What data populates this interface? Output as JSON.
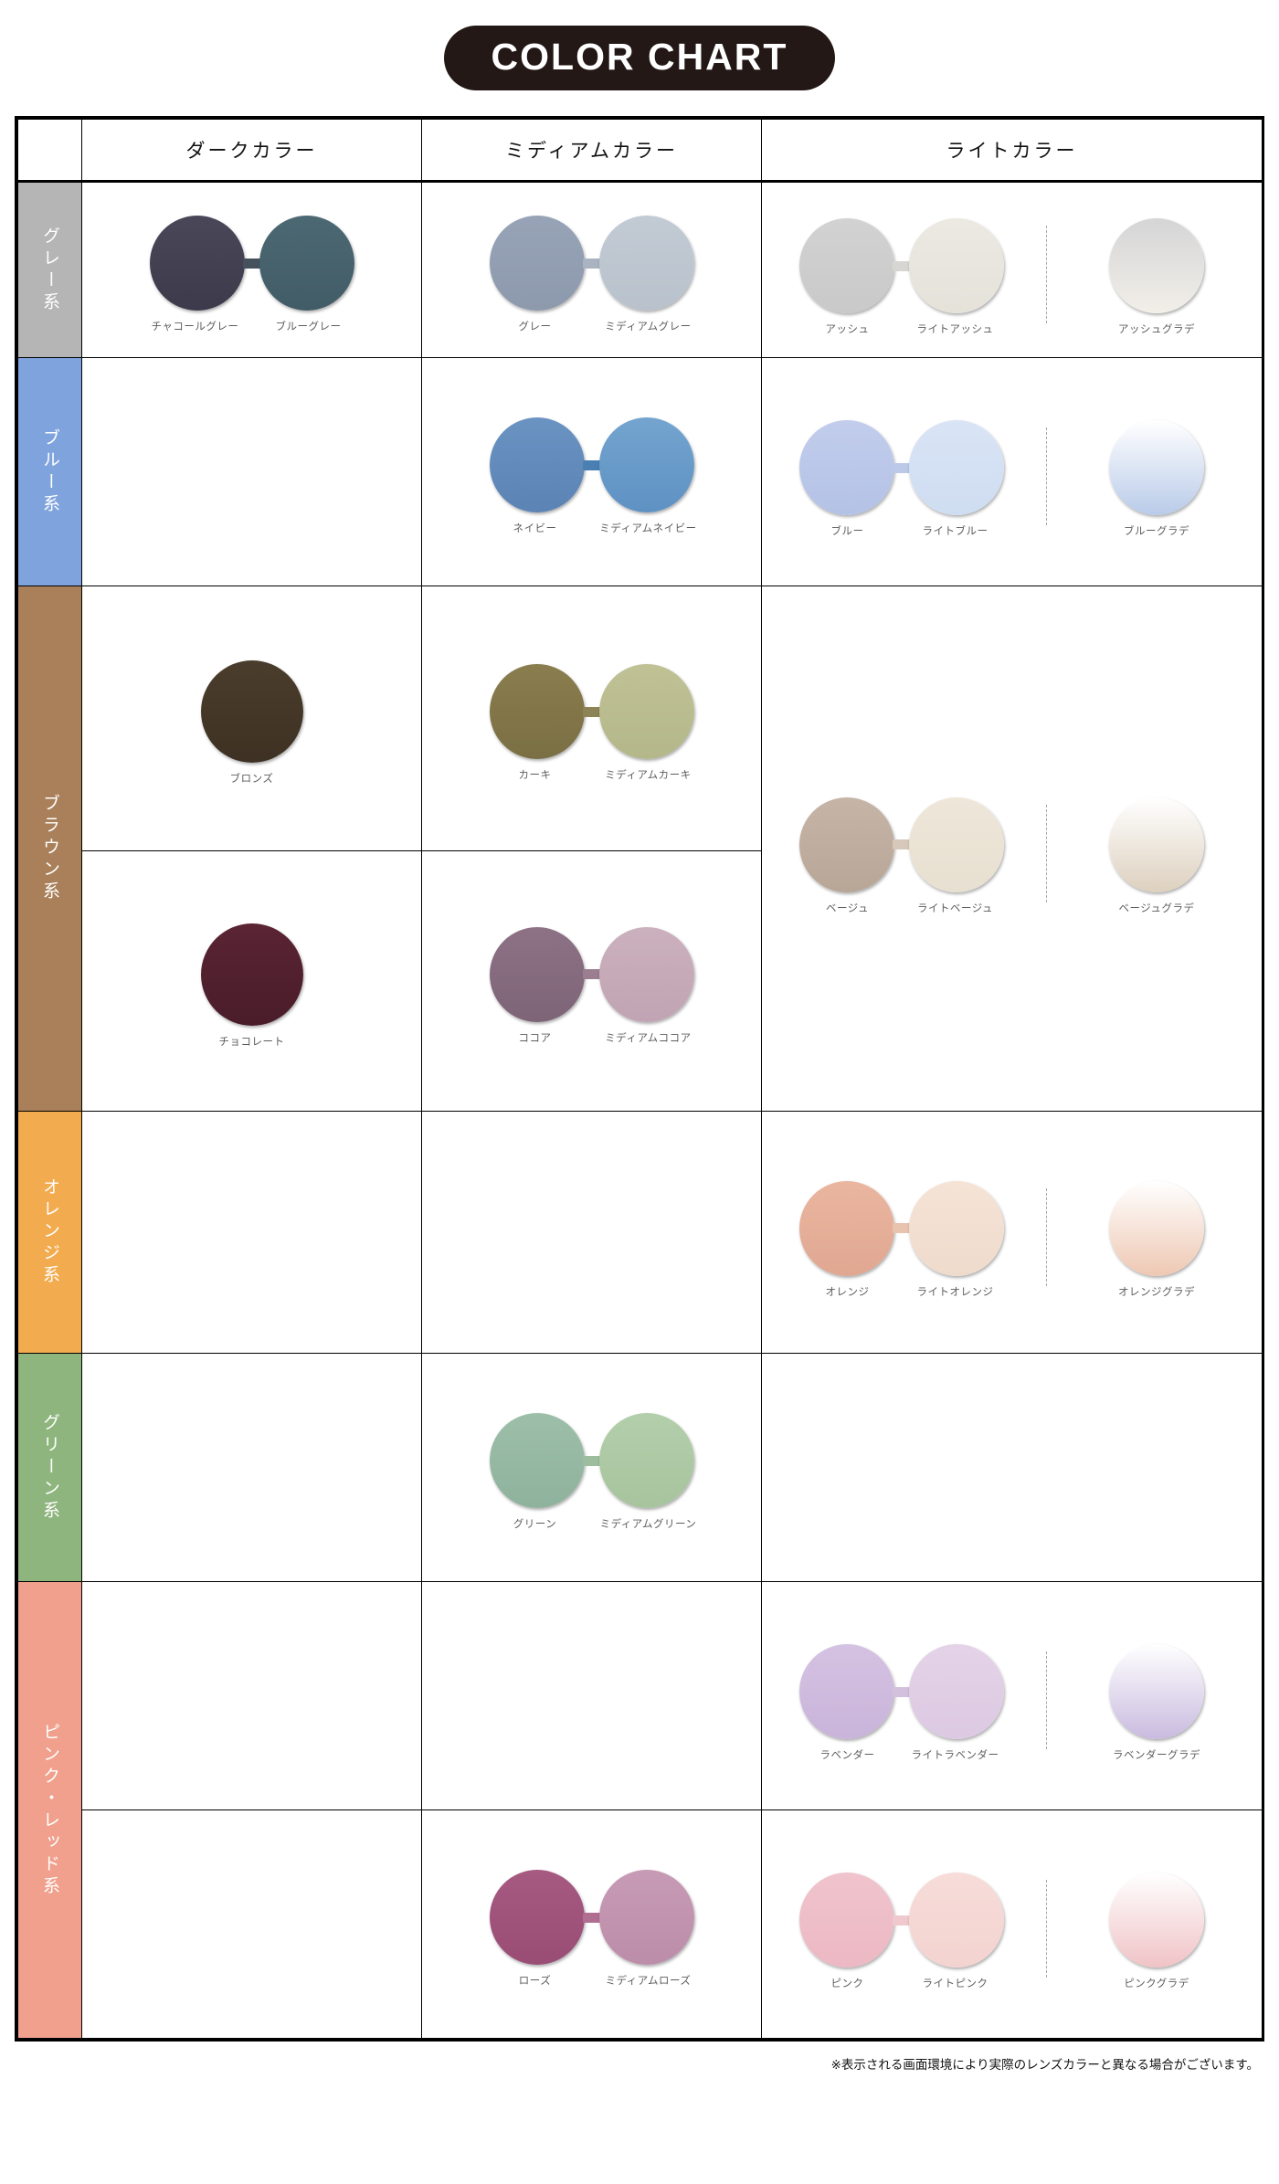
{
  "title": "COLOR CHART",
  "title_bg": "#231815",
  "columns": {
    "blank": "",
    "dark": "ダークカラー",
    "medium": "ミディアムカラー",
    "light": "ライトカラー"
  },
  "footnote": "※表示される画面環境により実際のレンズカラーと異なる場合がございます。",
  "rows": [
    {
      "tab_label": "グレー系",
      "tab_color": "#b5b5b5",
      "dark": {
        "type": "pair",
        "items": [
          {
            "label": "チャコールグレー",
            "top": "#4a4758",
            "bottom": "#3c3a4b"
          },
          {
            "label": "ブルーグレー",
            "top": "#4c6873",
            "bottom": "#415c66"
          }
        ],
        "bridge": "#45525e"
      },
      "medium": {
        "type": "pair",
        "items": [
          {
            "label": "グレー",
            "top": "#97a3b6",
            "bottom": "#8d99ac"
          },
          {
            "label": "ミディアムグレー",
            "top": "#c2cbd4",
            "bottom": "#b9c2cc"
          }
        ],
        "bridge": "#a9b4c0"
      },
      "light": {
        "type": "light",
        "items": [
          {
            "label": "アッシュ",
            "top": "#d2d2d2",
            "bottom": "#c9c9c9"
          },
          {
            "label": "ライトアッシュ",
            "top": "#ece9e2",
            "bottom": "#e5e2da"
          }
        ],
        "bridge": "#d8d6d2",
        "gradient": {
          "label": "アッシュグラデ",
          "top": "#d5d5d6",
          "bottom": "#f2efe9"
        }
      }
    },
    {
      "tab_label": "ブルー系",
      "tab_color": "#7fa3dc",
      "dark": {
        "type": "empty"
      },
      "medium": {
        "type": "pair",
        "items": [
          {
            "label": "ネイビー",
            "top": "#6a93c2",
            "bottom": "#5b83b4"
          },
          {
            "label": "ミディアムネイビー",
            "top": "#74a4cf",
            "bottom": "#5e92c3"
          }
        ],
        "bridge": "#4a7fb2"
      },
      "light": {
        "type": "light",
        "items": [
          {
            "label": "ブルー",
            "top": "#c2cdec",
            "bottom": "#b4c2e6"
          },
          {
            "label": "ライトブルー",
            "top": "#d9e4f5",
            "bottom": "#cfddf2"
          }
        ],
        "bridge": "#bcc9e8",
        "gradient": {
          "label": "ブルーグラデ",
          "top": "#ffffff",
          "bottom": "#b9cbe9"
        }
      }
    },
    {
      "tab_label": "ブラウン系",
      "tab_color": "#a9805a",
      "tab_span": 2,
      "dark": {
        "type": "single",
        "item": {
          "label": "ブロンズ",
          "top": "#4b3d2c",
          "bottom": "#3e3123"
        }
      },
      "medium": {
        "type": "pair",
        "items": [
          {
            "label": "カーキ",
            "top": "#8a7d4e",
            "bottom": "#7a6f44"
          },
          {
            "label": "ミディアムカーキ",
            "top": "#c0c296",
            "bottom": "#b4b78a"
          }
        ],
        "bridge": "#8c8456"
      },
      "light": {
        "type": "light",
        "items": [
          {
            "label": "ベージュ",
            "top": "#c6b5a7",
            "bottom": "#b8a697"
          },
          {
            "label": "ライトベージュ",
            "top": "#eee7d9",
            "bottom": "#e7e0d1"
          }
        ],
        "bridge": "#d6c8ba",
        "gradient": {
          "label": "ベージュグラデ",
          "top": "#ffffff",
          "bottom": "#ddd0be"
        }
      }
    },
    {
      "tab_label": "",
      "tab_color": "#a9805a",
      "tab_hidden": true,
      "dark": {
        "type": "single",
        "item": {
          "label": "チョコレート",
          "top": "#5a2434",
          "bottom": "#4a1c2a"
        }
      },
      "medium": {
        "type": "pair",
        "items": [
          {
            "label": "ココア",
            "top": "#8d7285",
            "bottom": "#7e6477"
          },
          {
            "label": "ミディアムココア",
            "top": "#cbb0bd",
            "bottom": "#c1a4b3"
          }
        ],
        "bridge": "#9b7f90"
      },
      "light": {
        "type": "rowspan-continue"
      }
    },
    {
      "tab_label": "オレンジ系",
      "tab_color": "#f2ab4e",
      "dark": {
        "type": "empty"
      },
      "medium": {
        "type": "empty"
      },
      "light": {
        "type": "light",
        "items": [
          {
            "label": "オレンジ",
            "top": "#eab69f",
            "bottom": "#e0a791"
          },
          {
            "label": "ライトオレンジ",
            "top": "#f5e3d6",
            "bottom": "#efdbcc"
          }
        ],
        "bridge": "#e8c3ae",
        "gradient": {
          "label": "オレンジグラデ",
          "top": "#ffffff",
          "bottom": "#eec8b3"
        }
      }
    },
    {
      "tab_label": "グリーン系",
      "tab_color": "#8fb57e",
      "dark": {
        "type": "empty"
      },
      "medium": {
        "type": "pair",
        "items": [
          {
            "label": "グリーン",
            "top": "#9dbfa9",
            "bottom": "#8fb29c"
          },
          {
            "label": "ミディアムグリーン",
            "top": "#b3ceab",
            "bottom": "#a7c49e"
          }
        ],
        "bridge": "#9cbd9e"
      },
      "light": {
        "type": "empty"
      }
    },
    {
      "tab_label": "ピンク・レッド系",
      "tab_color": "#f0a08c",
      "tab_span": 2,
      "dark": {
        "type": "empty"
      },
      "medium": {
        "type": "empty"
      },
      "light": {
        "type": "light",
        "items": [
          {
            "label": "ラベンダー",
            "top": "#d5c2e2",
            "bottom": "#c9b4da"
          },
          {
            "label": "ライトラベンダー",
            "top": "#e4d3e8",
            "bottom": "#dcc9e2"
          }
        ],
        "bridge": "#d3c0dd",
        "gradient": {
          "label": "ラベンダーグラデ",
          "top": "#ffffff",
          "bottom": "#c9bbdf"
        }
      }
    },
    {
      "tab_label": "",
      "tab_color": "#f0a08c",
      "tab_hidden": true,
      "dark": {
        "type": "empty"
      },
      "medium": {
        "type": "pair",
        "items": [
          {
            "label": "ローズ",
            "top": "#a65a82",
            "bottom": "#994d75"
          },
          {
            "label": "ミディアムローズ",
            "top": "#c79ab5",
            "bottom": "#bc8da9"
          }
        ],
        "bridge": "#b06f90"
      },
      "light": {
        "type": "light",
        "items": [
          {
            "label": "ピンク",
            "top": "#f0c4cd",
            "bottom": "#ecb8c3"
          },
          {
            "label": "ライトピンク",
            "top": "#f7dcd9",
            "bottom": "#f3d3d0"
          }
        ],
        "bridge": "#efc9cd",
        "gradient": {
          "label": "ピンクグラデ",
          "top": "#ffffff",
          "bottom": "#f0c3c6"
        }
      }
    }
  ]
}
